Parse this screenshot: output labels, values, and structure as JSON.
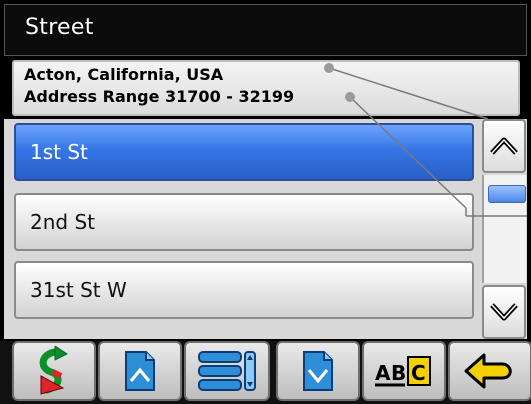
{
  "window": {
    "title": "Street"
  },
  "info": {
    "location": "Acton, California, USA",
    "address_range": "Address Range 31700 - 32199"
  },
  "streets": {
    "items": [
      {
        "label": "1st St",
        "selected": true
      },
      {
        "label": "2nd St",
        "selected": false
      },
      {
        "label": "31st St W",
        "selected": false
      }
    ]
  },
  "toolbar": {
    "buttons": [
      {
        "icon": "go-route-icon"
      },
      {
        "icon": "page-up-icon"
      },
      {
        "icon": "list-view-icon"
      },
      {
        "icon": "page-down-icon"
      },
      {
        "icon": "abc-keyboard-icon"
      },
      {
        "icon": "back-arrow-icon"
      }
    ]
  },
  "colors": {
    "selection": "#3576e6",
    "title_bar": "#0b0b0b",
    "accent_yellow": "#f5d000"
  }
}
